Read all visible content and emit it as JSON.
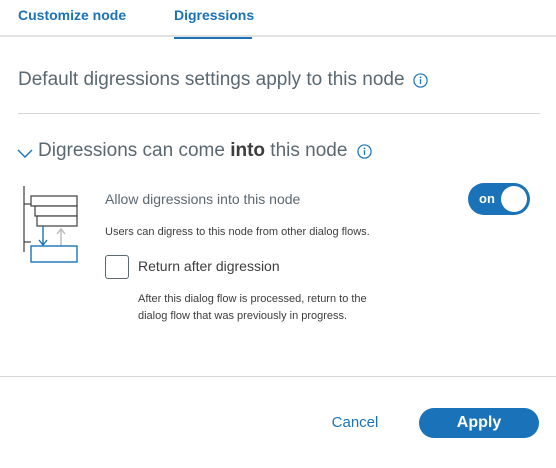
{
  "tabs": {
    "customize_node": "Customize node",
    "digressions": "Digressions"
  },
  "defaults": {
    "title": "Default digressions settings apply to this node"
  },
  "into_section": {
    "title_prefix": "Digressions can come ",
    "title_bold": "into",
    "title_suffix": " this node",
    "allow_label": "Allow digressions into this node",
    "allow_description": "Users can digress to this node from other dialog flows.",
    "toggle_label": "on",
    "toggle_on": true,
    "return_label": "Return after digression",
    "return_checked": false,
    "return_description": "After this dialog flow is processed, return to the dialog flow that was previously in progress."
  },
  "footer": {
    "cancel_label": "Cancel",
    "apply_label": "Apply"
  },
  "colors": {
    "accent": "#1a73b8",
    "heading": "#5a6872",
    "text": "#3d3d3d"
  },
  "icons": [
    "info-icon",
    "chevron-down-icon",
    "digression-diagram-icon"
  ]
}
